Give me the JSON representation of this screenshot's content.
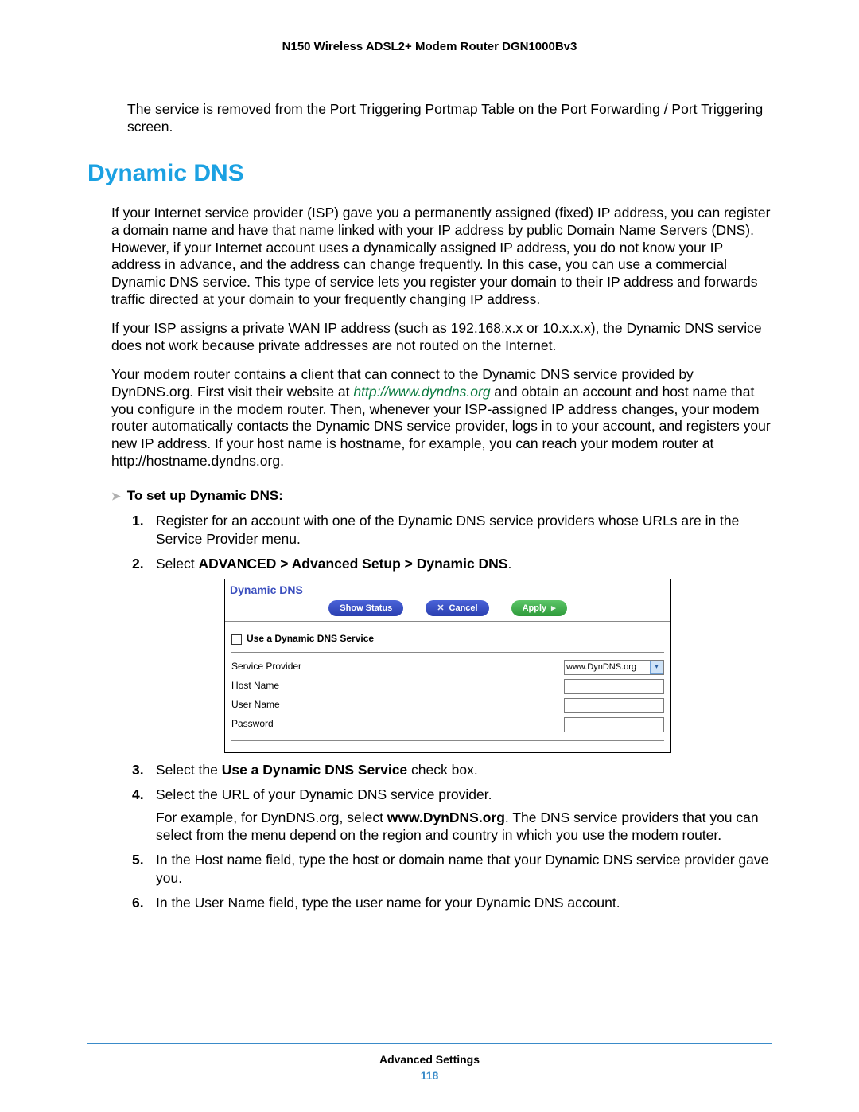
{
  "header": {
    "product": "N150 Wireless ADSL2+ Modem Router DGN1000Bv3"
  },
  "intro": "The service is removed from the Port Triggering Portmap Table on the Port Forwarding / Port Triggering screen.",
  "heading": "Dynamic DNS",
  "p1": "If your Internet service provider (ISP) gave you a permanently assigned (fixed) IP address, you can register a domain name and have that name linked with your IP address by public Domain Name Servers (DNS). However, if your Internet account uses a dynamically assigned IP address, you do not know your IP address in advance, and the address can change frequently. In this case, you can use a commercial Dynamic DNS service. This type of service lets you register your domain to their IP address and forwards traffic directed at your domain to your frequently changing IP address.",
  "p2": "If your ISP assigns a private WAN IP address (such as 192.168.x.x or 10.x.x.x), the Dynamic DNS service does not work because private addresses are not routed on the Internet.",
  "p3a": "Your modem router contains a client that can connect to the Dynamic DNS service provided by DynDNS.org. First visit their website at ",
  "p3_link": "http://www.dyndns.org",
  "p3b": " and obtain an account and host name that you configure in the modem router. Then, whenever your ISP-assigned IP address changes, your modem router automatically contacts the Dynamic DNS service provider, logs in to your account, and registers your new IP address. If your host name is hostname, for example, you can reach your modem router at http://hostname.dyndns.org.",
  "procedure_title": "To set up Dynamic DNS:",
  "steps": {
    "s1": "Register for an account with one of the Dynamic DNS service providers whose URLs are in the Service Provider menu.",
    "s2a": "Select ",
    "s2b": "ADVANCED > Advanced Setup > Dynamic DNS",
    "s2c": ".",
    "s3a": "Select the ",
    "s3b": "Use a Dynamic DNS Service",
    "s3c": " check box.",
    "s4": "Select the URL of your Dynamic DNS service provider.",
    "s4suba": "For example, for DynDNS.org, select ",
    "s4subb": "www.DynDNS.org",
    "s4subc": ". The DNS service providers that you can select from the menu depend on the region and country in which you use the modem router.",
    "s5": "In the Host name field, type the host or domain name that your Dynamic DNS service provider gave you.",
    "s6": "In the User Name field, type the user name for your Dynamic DNS account."
  },
  "screenshot": {
    "title": "Dynamic DNS",
    "btn_status": "Show Status",
    "btn_cancel": "Cancel",
    "btn_apply": "Apply",
    "checkbox_label": "Use a Dynamic DNS Service",
    "rows": {
      "provider": {
        "label": "Service Provider",
        "value": "www.DynDNS.org"
      },
      "host": {
        "label": "Host Name"
      },
      "user": {
        "label": "User Name"
      },
      "pass": {
        "label": "Password"
      }
    }
  },
  "footer": {
    "section": "Advanced Settings",
    "page": "118"
  }
}
